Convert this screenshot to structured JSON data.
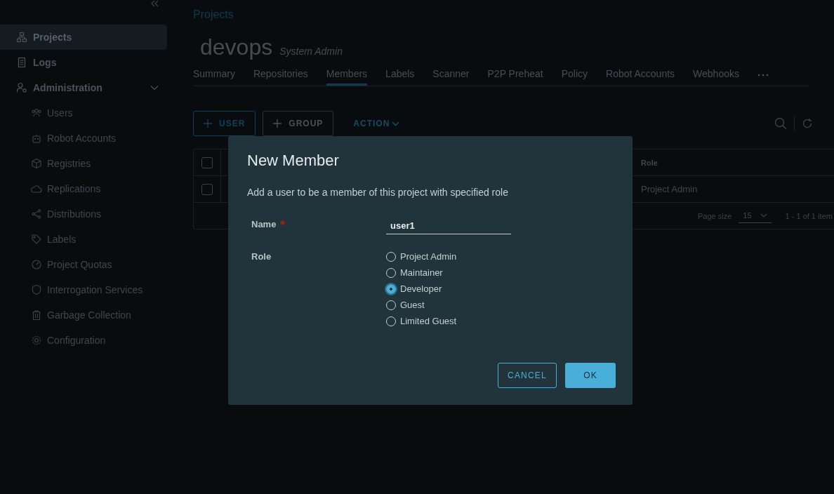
{
  "sidebar": {
    "items": [
      {
        "label": "Projects",
        "selected": true
      },
      {
        "label": "Logs",
        "selected": false
      },
      {
        "label": "Administration",
        "selected": false,
        "expanded": true,
        "children": [
          {
            "label": "Users",
            "selected": false
          },
          {
            "label": "Robot Accounts",
            "selected": false
          },
          {
            "label": "Registries",
            "selected": false
          },
          {
            "label": "Replications",
            "selected": false
          },
          {
            "label": "Distributions",
            "selected": false
          },
          {
            "label": "Labels",
            "selected": false
          },
          {
            "label": "Project Quotas",
            "selected": false
          },
          {
            "label": "Interrogation Services",
            "selected": false
          },
          {
            "label": "Garbage Collection",
            "selected": false
          },
          {
            "label": "Configuration",
            "selected": false
          }
        ]
      }
    ]
  },
  "breadcrumb": "Projects",
  "project": {
    "name": "devops",
    "role": "System Admin"
  },
  "tabs": [
    {
      "label": "Summary",
      "selected": false
    },
    {
      "label": "Repositories",
      "selected": false
    },
    {
      "label": "Members",
      "selected": true
    },
    {
      "label": "Labels",
      "selected": false
    },
    {
      "label": "Scanner",
      "selected": false
    },
    {
      "label": "P2P Preheat",
      "selected": false
    },
    {
      "label": "Policy",
      "selected": false
    },
    {
      "label": "Robot Accounts",
      "selected": false
    },
    {
      "label": "Webhooks",
      "selected": false
    }
  ],
  "toolbar": {
    "buttons": [
      {
        "label": "USER",
        "disabled": false
      },
      {
        "label": "GROUP",
        "disabled": true
      }
    ],
    "action": "ACTION"
  },
  "table": {
    "all_checked": false,
    "columns": [
      "Role"
    ],
    "rows": [
      {
        "checked": false,
        "role": "Project Admin"
      }
    ],
    "footer": {
      "page_size_label": "Page size",
      "page_size": "15",
      "range": "1 - 1 of 1 item"
    }
  },
  "dialog": {
    "title": "New Member",
    "description": "Add a user to be a member of this project with specified role",
    "name": {
      "label": "Name",
      "required": true,
      "value": "user1"
    },
    "role": {
      "label": "Role",
      "options": [
        {
          "label": "Project Admin",
          "selected": false
        },
        {
          "label": "Maintainer",
          "selected": false
        },
        {
          "label": "Developer",
          "selected": true
        },
        {
          "label": "Guest",
          "selected": false
        },
        {
          "label": "Limited Guest",
          "selected": false
        }
      ]
    },
    "buttons": {
      "cancel": "CANCEL",
      "ok": "OK"
    }
  }
}
